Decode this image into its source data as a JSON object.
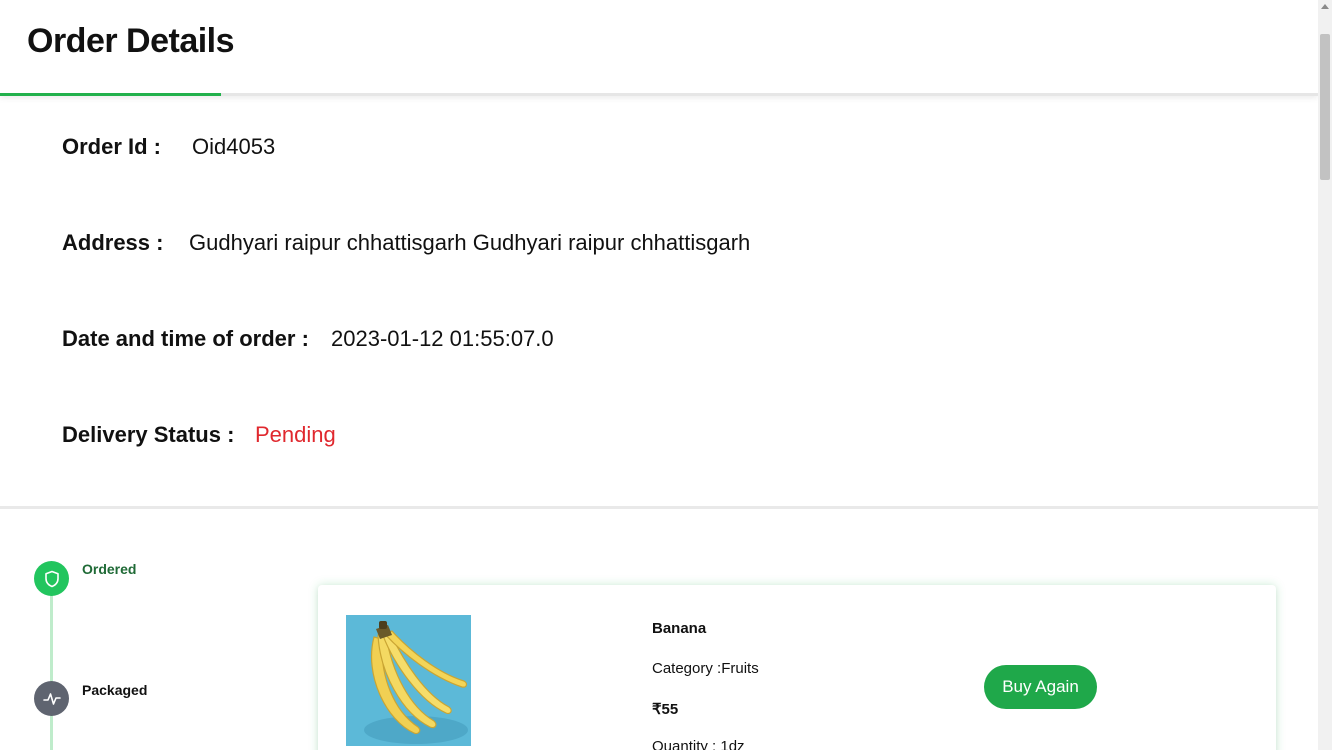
{
  "page": {
    "title": "Order Details"
  },
  "order": {
    "id_label": "Order Id :",
    "id_value": "Oid4053",
    "address_label": "Address :",
    "address_value": "Gudhyari raipur chhattisgarh Gudhyari raipur chhattisgarh",
    "date_label": "Date and time of order :",
    "date_value": "2023-01-12 01:55:07.0",
    "status_label": "Delivery Status :",
    "status_value": "Pending"
  },
  "timeline": {
    "steps": [
      {
        "label": "Ordered",
        "state": "done",
        "icon": "shield-icon"
      },
      {
        "label": "Packaged",
        "state": "pending",
        "icon": "activity-icon"
      }
    ]
  },
  "product": {
    "name": "Banana",
    "category": "Category :Fruits",
    "price": "₹55",
    "quantity": "Quantity : 1dz",
    "image": "banana-image",
    "buy_again_label": "Buy Again"
  },
  "colors": {
    "accent": "#22b14c",
    "status_pending": "#e0282e",
    "button": "#1fa84a"
  }
}
